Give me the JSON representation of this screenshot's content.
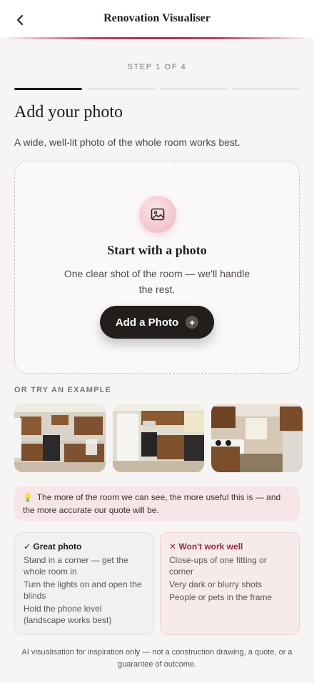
{
  "header": {
    "title": "Renovation Visualiser",
    "back_icon": "chevron-left-icon"
  },
  "step": {
    "label": "STEP 1 OF 4",
    "current": 1,
    "total": 4
  },
  "page": {
    "heading": "Add your photo",
    "subtitle": "A wide, well-lit photo of the whole room works best."
  },
  "dropzone": {
    "icon": "image-icon",
    "title": "Start with a photo",
    "description": "One clear shot of the room — we'll handle the rest.",
    "button_label": "Add a Photo",
    "button_icon": "plus-icon"
  },
  "examples": {
    "label": "OR TRY AN EXAMPLE",
    "items": [
      {
        "name": "kitchen-example-1"
      },
      {
        "name": "kitchen-example-2"
      },
      {
        "name": "kitchen-example-3"
      }
    ]
  },
  "tip": {
    "icon": "lightbulb-icon",
    "text": "The more of the room we can see, the more useful this is — and the more accurate our quote will be."
  },
  "good": {
    "title": "✓ Great photo",
    "items": [
      "Stand in a corner — get the whole room in",
      "Turn the lights on and open the blinds",
      "Hold the phone level (landscape works best)"
    ]
  },
  "bad": {
    "title": "✕ Won't work well",
    "items": [
      "Close-ups of one fitting or corner",
      "Very dark or blurry shots",
      "People or pets in the frame"
    ]
  },
  "footer": {
    "text": "AI visualisation for inspiration only — not a construction drawing, a quote, or a guarantee of outcome."
  },
  "colors": {
    "accent": "#a82840",
    "primary_button": "#231e1c",
    "tip_background": "#f7e6e7"
  }
}
